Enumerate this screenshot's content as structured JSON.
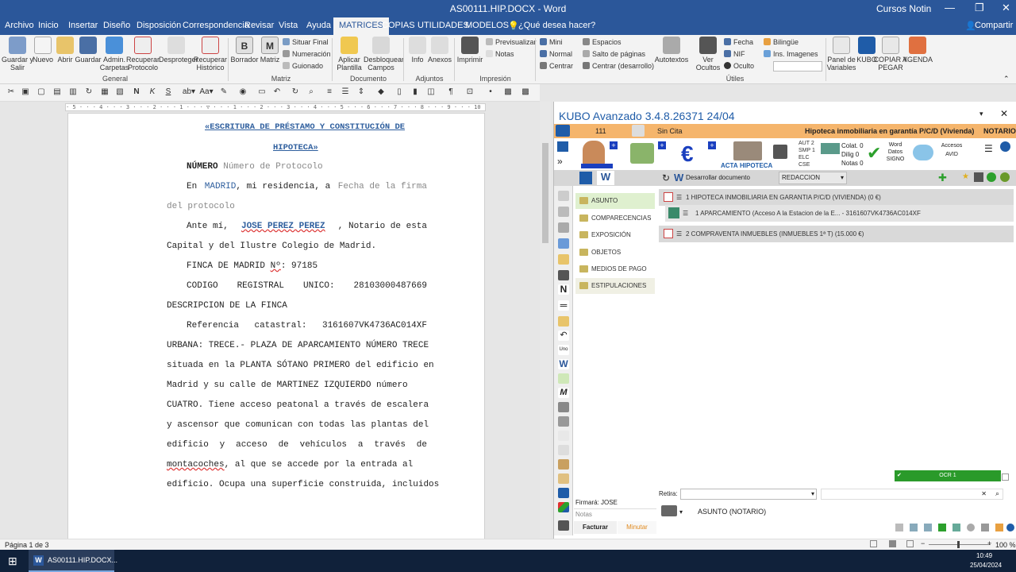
{
  "window": {
    "title": "AS00111.HIP.DOCX - Word",
    "user": "Cursos Notin",
    "share": "Compartir"
  },
  "tabs": [
    "Archivo",
    "Inicio",
    "Insertar",
    "Diseño",
    "Disposición",
    "Correspondencia",
    "Revisar",
    "Vista",
    "Ayuda",
    "MATRICES",
    "COPIAS",
    "UTILIDADES",
    "MODELOS"
  ],
  "tell_me": "¿Qué desea hacer?",
  "ribbon": {
    "general": {
      "label": "General",
      "buttons": [
        "Guardar y Salir",
        "Nuevo",
        "Abrir",
        "Guardar",
        "Admin. Carpetas",
        "Recuperar Protocolo",
        "Desproteger",
        "Recuperar Histórico"
      ]
    },
    "matriz": {
      "label": "Matriz",
      "buttons": [
        "Borrador",
        "Matriz"
      ],
      "small": [
        "Situar Final",
        "Numeración",
        "Guionado"
      ]
    },
    "documento": {
      "label": "Documento",
      "buttons": [
        "Aplicar Plantilla",
        "Desbloquear Campos"
      ]
    },
    "adjuntos": {
      "label": "Adjuntos",
      "buttons": [
        "Info",
        "Anexos"
      ]
    },
    "impresion": {
      "label": "Impresión",
      "buttons": [
        "Imprimir"
      ],
      "small": [
        "Previsualizar",
        "Notas"
      ]
    },
    "utiles": {
      "label": "Útiles",
      "small_a": [
        "Mini",
        "Normal",
        "Centrar"
      ],
      "small_b": [
        "Espacios",
        "Salto de páginas",
        "Centrar (desarrollo)"
      ],
      "buttons": [
        "Autotextos",
        "Ver Ocultos"
      ],
      "small_c": [
        "Fecha",
        "NIF",
        "Oculto"
      ],
      "small_d": [
        "Bilingüe",
        "Ins. Imagenes"
      ]
    },
    "extra": [
      "Panel de Variables",
      "KUBO",
      "COPIAR Y PEGAR",
      "AGENDA"
    ]
  },
  "document": {
    "lines": [
      {
        "t": "«ESCRITURA DE PRÉSTAMO Y CONSTITUCIÓN DE"
      },
      {
        "t": "HIPOTECA»"
      },
      {
        "a": "NÚMERO",
        "b": "Número de Protocolo"
      },
      {
        "a": "En",
        "b": "MADRID",
        "c": ", mi residencia, a",
        "d": "Fecha de la firma"
      },
      {
        "t": "del protocolo"
      },
      {
        "a": "Ante mí,",
        "b": "JOSE PEREZ PEREZ",
        "c": ", Notario de esta"
      },
      {
        "t": "Capital y del Ilustre Colegio de Madrid."
      },
      {
        "a": "FINCA DE MADRID",
        "b": "Nº",
        "c": ": 97185"
      },
      {
        "w": [
          "CODIGO",
          "REGISTRAL",
          "UNICO:",
          "28103000487669"
        ]
      },
      {
        "t": "DESCRIPCION DE LA FINCA"
      },
      {
        "w": [
          "Referencia",
          "catastral:",
          "3161607VK4736AC014XF"
        ]
      },
      {
        "t": "URBANA: TRECE.- PLAZA DE APARCAMIENTO NÚMERO TRECE"
      },
      {
        "t": "situada en la PLANTA SÓTANO PRIMERO del edificio en"
      },
      {
        "t": "Madrid y su calle de MARTINEZ IZQUIERDO número"
      },
      {
        "t": "CUATRO. Tiene acceso peatonal a través de escalera"
      },
      {
        "t": "y ascensor que comunican con todas las plantas del"
      },
      {
        "w": [
          "edificio",
          "y",
          "acceso",
          "de",
          "vehículos",
          "a",
          "través",
          "de"
        ]
      },
      {
        "a": "montacoches",
        "b": ", al que se accede por la entrada al"
      },
      {
        "t": "edificio. Ocupa una superficie construida, incluidos"
      }
    ]
  },
  "status": {
    "page": "Página 1 de 3",
    "zoom": "100 %"
  },
  "taskbar": {
    "app": "AS00111.HIP.DOCX...",
    "time": "10:49",
    "date": "25/04/2024"
  },
  "kubo": {
    "title": "KUBO Avanzado 3.4.8.26371   24/04",
    "bar": {
      "num": "111",
      "cita": "Sin Cita",
      "desc": "Hipoteca inmobiliaria en garantía P/C/D (Vivienda)",
      "role": "NOTARIO"
    },
    "tools": {
      "acta": "ACTA",
      "hipoteca": "HIPOTECA",
      "aut": "AUT",
      "aut_n": "2",
      "smp": "SMP",
      "smp_n": "1",
      "elc": "ELC",
      "cse": "CSE",
      "colat": "Colat. 0",
      "dilig": "Dilig 0",
      "notas": "Notas 0",
      "word": "Word Datos SIGNO",
      "accesos": "Accesos AVID"
    },
    "bar2": {
      "desarrollar": "Desarrollar documento",
      "redaccion": "REDACCION"
    },
    "nav": [
      "ASUNTO",
      "COMPARECENCIAS",
      "EXPOSICIÓN",
      "OBJETOS",
      "MEDIOS DE PAGO",
      "ESTIPULACIONES"
    ],
    "rows": [
      "1 HIPOTECA INMOBILIARIA EN GARANTIA P/C/D (VIVIENDA) (0 €)",
      "1  APARCAMIENTO (Acceso A la Estacion de la E... - 3161607VK4736AC014XF",
      "2 COMPRAVENTA INMUEBLES (INMUEBLES 1ª T) (15.000 €)"
    ],
    "ocr": "OCR 1",
    "firmara": "Firmará: JOSE",
    "notas_label": "Notas",
    "retira_label": "Retira:",
    "asunto": "ASUNTO (NOTARIO)",
    "facturar": "Facturar",
    "minutar": "Minutar"
  }
}
